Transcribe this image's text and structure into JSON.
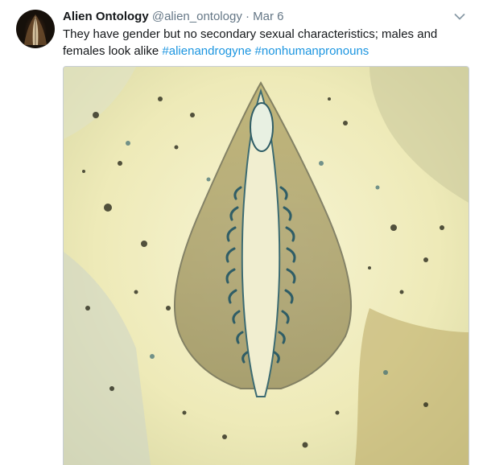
{
  "tweet": {
    "author_name": "Alien Ontology",
    "author_handle": "@alien_ontology",
    "separator": "·",
    "timestamp": "Mar 6",
    "text": "They have gender but no secondary sexual characteristics; males and females look alike",
    "hashtags": [
      "#alienandrogyne",
      "#nonhumanpronouns"
    ],
    "menu_icon": "chevron-down-icon",
    "avatar_icon": "avatar",
    "media_description_icon": "tweet-image"
  },
  "colors": {
    "name": "#14171a",
    "meta": "#657786",
    "hashtag": "#1b95e0",
    "border": "#c7ced4"
  }
}
